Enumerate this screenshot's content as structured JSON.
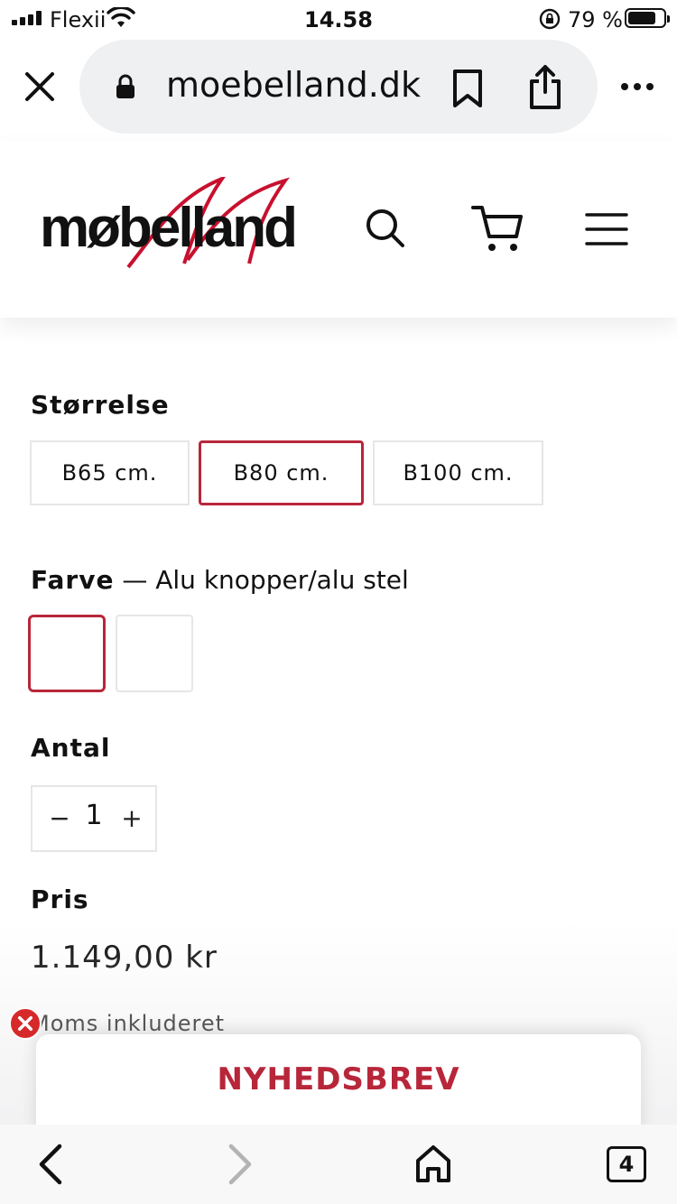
{
  "status_bar": {
    "carrier": "Flexii",
    "time": "14.58",
    "battery": "79 %",
    "battery_level": 0.79
  },
  "browser": {
    "url": "moebelland.dk",
    "tab_count": "4"
  },
  "store": {
    "logo_text": "møbelland",
    "brand_color": "#b8263a"
  },
  "product": {
    "size": {
      "heading": "Størrelse",
      "options": [
        "B65 cm.",
        "B80 cm.",
        "B100 cm."
      ],
      "selected_index": 1
    },
    "color": {
      "heading": "Farve",
      "separator": " — ",
      "selected_label": "Alu knopper/alu stel",
      "swatch_count": 2,
      "selected_index": 0
    },
    "quantity": {
      "heading": "Antal",
      "value": "1",
      "minus": "−",
      "plus": "+"
    },
    "price": {
      "heading": "Pris",
      "value": "1.149,00 kr",
      "vat_note": "Moms inkluderet"
    }
  },
  "newsletter": {
    "title": "NYHEDSBREV"
  },
  "icons": {
    "close_tab": "close-icon",
    "lock": "lock-icon",
    "bookmark": "bookmark-icon",
    "share": "share-icon",
    "more": "more-icon",
    "search": "search-icon",
    "cart": "cart-icon",
    "menu": "hamburger-menu-icon",
    "back": "chevron-left-icon",
    "forward": "chevron-right-icon",
    "home": "home-icon"
  }
}
